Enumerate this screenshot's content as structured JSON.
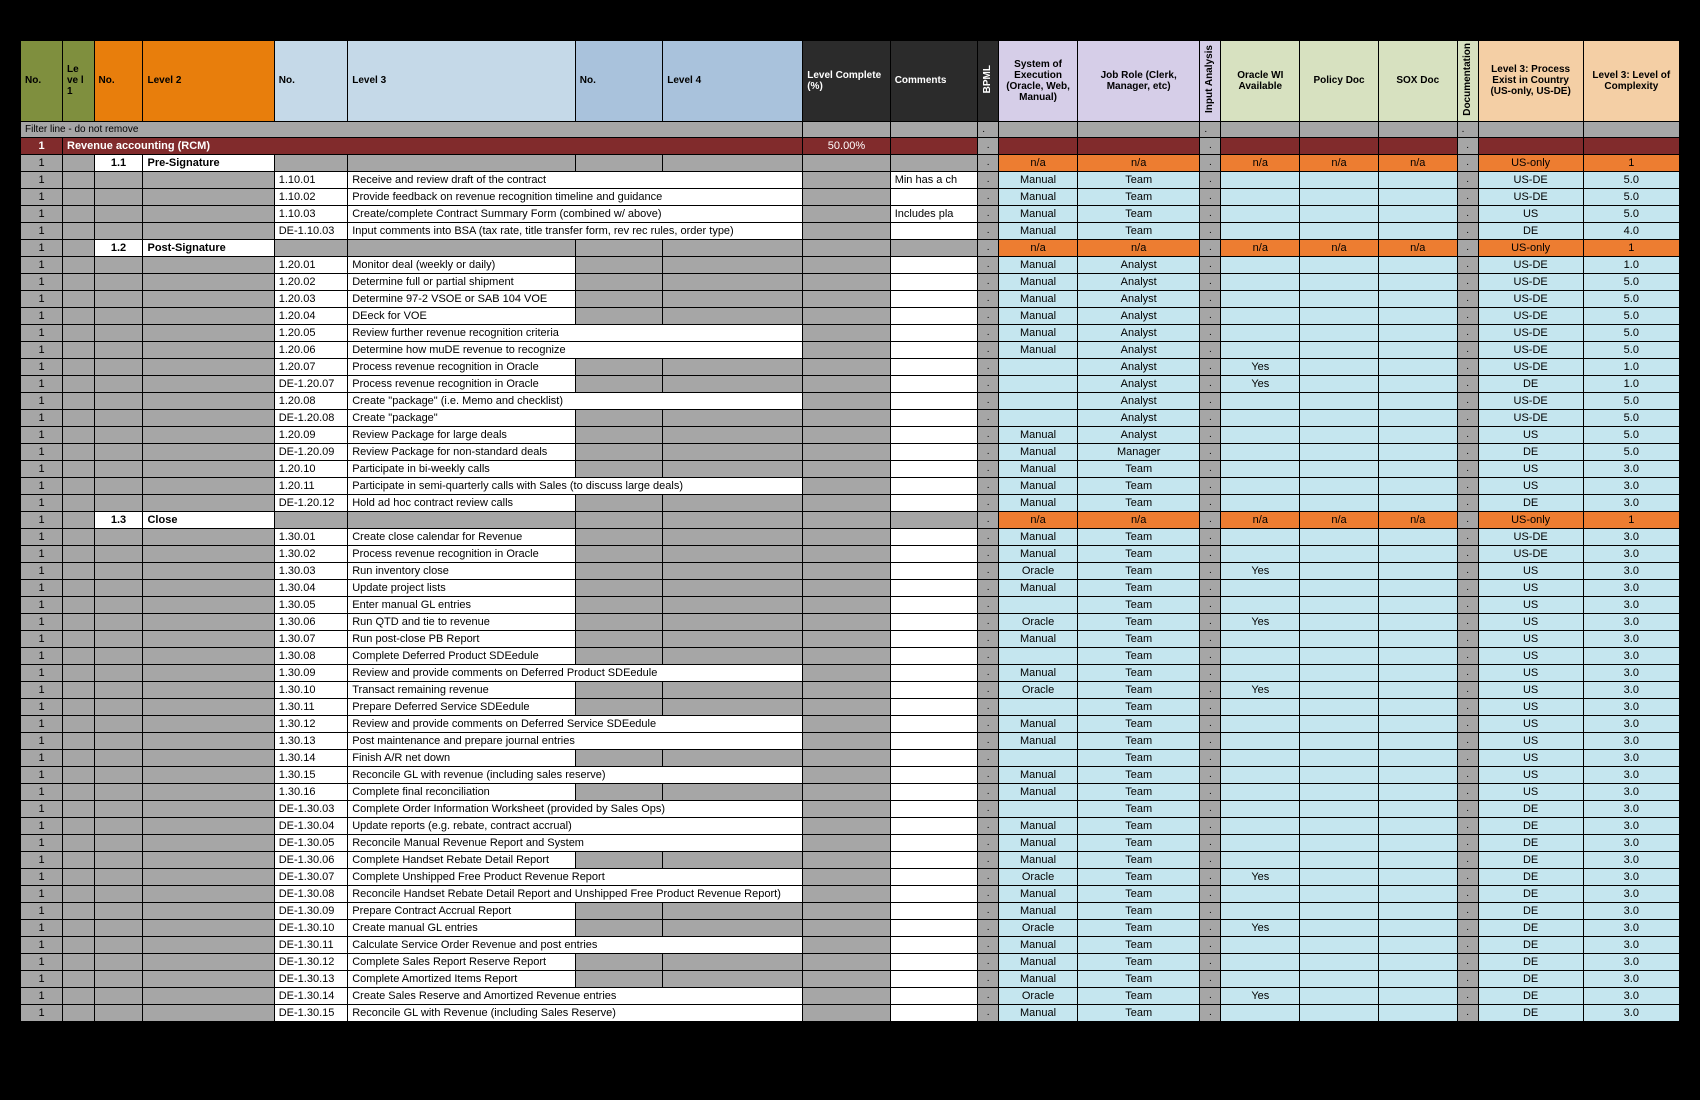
{
  "headers": {
    "no1": "No.",
    "lvl1": "Le ve l 1",
    "no2": "No.",
    "lvl2": "Level 2",
    "no3": "No.",
    "lvl3": "Level 3",
    "no4": "No.",
    "lvl4": "Level 4",
    "pct": "Level Complete (%)",
    "comments": "Comments",
    "bpml": "BPML",
    "system": "System of Execution (Oracle, Web, Manual)",
    "job": "Job Role (Clerk, Manager, etc)",
    "input": "Input Analysis",
    "oracle": "Oracle WI Available",
    "policy": "Policy Doc",
    "sox": "SOX Doc",
    "docu": "Documentation",
    "country": "Level 3: Process Exist in Country (US-only, US-DE)",
    "complexity": "Level 3: Level of Complexity"
  },
  "filterLine": "Filter line - do not remove",
  "dot": ".",
  "na": "n/a",
  "topRow": {
    "no1": "1",
    "title": "Revenue accounting (RCM)",
    "pct": "50.00%"
  },
  "groups": [
    {
      "no": "1.1",
      "name": "Pre-Signature",
      "country": "US-only",
      "cx": "1"
    },
    {
      "no": "1.2",
      "name": "Post-Signature",
      "country": "US-only",
      "cx": "1"
    },
    {
      "no": "1.3",
      "name": "Close",
      "country": "US-only",
      "cx": "1"
    }
  ],
  "rows": [
    {
      "g": 0,
      "c4": "1.10.01",
      "c5": "Receive and review draft of the contract",
      "comments": "Min has a ch",
      "sys": "Manual",
      "job": "Team",
      "country": "US-DE",
      "cx": "5.0"
    },
    {
      "g": 0,
      "c4": "1.10.02",
      "c5": "Provide feedback on revenue recognition timeline and guidance",
      "sys": "Manual",
      "job": "Team",
      "country": "US-DE",
      "cx": "5.0"
    },
    {
      "g": 0,
      "c4": "1.10.03",
      "c5": "Create/complete Contract Summary Form (combined w/ above)",
      "comments": "Includes pla",
      "sys": "Manual",
      "job": "Team",
      "country": "US",
      "cx": "5.0"
    },
    {
      "g": 0,
      "c4": "DE-1.10.03",
      "c5": "Input comments into BSA (tax rate, title transfer form, rev rec rules, order type)",
      "sys": "Manual",
      "job": "Team",
      "country": "DE",
      "cx": "4.0"
    },
    {
      "g": 1,
      "c4": "1.20.01",
      "c5": "Monitor deal (weekly or daily)",
      "sys": "Manual",
      "job": "Analyst",
      "country": "US-DE",
      "cx": "1.0"
    },
    {
      "g": 1,
      "c4": "1.20.02",
      "c5": "Determine full or partial shipment",
      "sys": "Manual",
      "job": "Analyst",
      "country": "US-DE",
      "cx": "5.0"
    },
    {
      "g": 1,
      "c4": "1.20.03",
      "c5": "Determine 97-2 VSOE or SAB 104 VOE",
      "sys": "Manual",
      "job": "Analyst",
      "country": "US-DE",
      "cx": "5.0"
    },
    {
      "g": 1,
      "c4": "1.20.04",
      "c5": "DEeck for VOE",
      "sys": "Manual",
      "job": "Analyst",
      "country": "US-DE",
      "cx": "5.0"
    },
    {
      "g": 1,
      "c4": "1.20.05",
      "c5": "Review further revenue recognition criteria",
      "sys": "Manual",
      "job": "Analyst",
      "country": "US-DE",
      "cx": "5.0"
    },
    {
      "g": 1,
      "c4": "1.20.06",
      "c5": "Determine how muDE revenue to recognize",
      "sys": "Manual",
      "job": "Analyst",
      "country": "US-DE",
      "cx": "5.0"
    },
    {
      "g": 1,
      "c4": "1.20.07",
      "c5": "Process revenue recognition in Oracle",
      "job": "Analyst",
      "oracle": "Yes",
      "country": "US-DE",
      "cx": "1.0"
    },
    {
      "g": 1,
      "c4": "DE-1.20.07",
      "c5": "Process revenue recognition in Oracle",
      "job": "Analyst",
      "oracle": "Yes",
      "country": "DE",
      "cx": "1.0"
    },
    {
      "g": 1,
      "c4": "1.20.08",
      "c5": "Create \"package\" (i.e. Memo and checklist)",
      "job": "Analyst",
      "country": "US-DE",
      "cx": "5.0"
    },
    {
      "g": 1,
      "c4": "DE-1.20.08",
      "c5": "Create \"package\"",
      "job": "Analyst",
      "country": "US-DE",
      "cx": "5.0"
    },
    {
      "g": 1,
      "c4": "1.20.09",
      "c5": "Review Package for large deals",
      "sys": "Manual",
      "job": "Analyst",
      "country": "US",
      "cx": "5.0"
    },
    {
      "g": 1,
      "c4": "DE-1.20.09",
      "c5": "Review Package for non-standard deals",
      "sys": "Manual",
      "job": "Manager",
      "country": "DE",
      "cx": "5.0"
    },
    {
      "g": 1,
      "c4": "1.20.10",
      "c5": "Participate in bi-weekly calls",
      "sys": "Manual",
      "job": "Team",
      "country": "US",
      "cx": "3.0"
    },
    {
      "g": 1,
      "c4": "1.20.11",
      "c5": "Participate in semi-quarterly calls with Sales (to discuss large deals)",
      "sys": "Manual",
      "job": "Team",
      "country": "US",
      "cx": "3.0"
    },
    {
      "g": 1,
      "c4": "DE-1.20.12",
      "c5": "Hold ad hoc contract review calls",
      "sys": "Manual",
      "job": "Team",
      "country": "DE",
      "cx": "3.0"
    },
    {
      "g": 2,
      "c4": "1.30.01",
      "c5": "Create close calendar for Revenue",
      "sys": "Manual",
      "job": "Team",
      "country": "US-DE",
      "cx": "3.0"
    },
    {
      "g": 2,
      "c4": "1.30.02",
      "c5": "Process revenue recognition in Oracle",
      "sys": "Manual",
      "job": "Team",
      "country": "US-DE",
      "cx": "3.0"
    },
    {
      "g": 2,
      "c4": "1.30.03",
      "c5": "Run inventory close",
      "sys": "Oracle",
      "job": "Team",
      "oracle": "Yes",
      "country": "US",
      "cx": "3.0"
    },
    {
      "g": 2,
      "c4": "1.30.04",
      "c5": "Update project lists",
      "sys": "Manual",
      "job": "Team",
      "country": "US",
      "cx": "3.0"
    },
    {
      "g": 2,
      "c4": "1.30.05",
      "c5": "Enter manual GL entries",
      "job": "Team",
      "country": "US",
      "cx": "3.0"
    },
    {
      "g": 2,
      "c4": "1.30.06",
      "c5": "Run QTD and tie to revenue",
      "sys": "Oracle",
      "job": "Team",
      "oracle": "Yes",
      "country": "US",
      "cx": "3.0"
    },
    {
      "g": 2,
      "c4": "1.30.07",
      "c5": "Run post-close PB Report",
      "sys": "Manual",
      "job": "Team",
      "country": "US",
      "cx": "3.0"
    },
    {
      "g": 2,
      "c4": "1.30.08",
      "c5": "Complete Deferred Product SDEedule",
      "job": "Team",
      "country": "US",
      "cx": "3.0"
    },
    {
      "g": 2,
      "c4": "1.30.09",
      "c5": "Review and provide comments on Deferred Product SDEedule",
      "sys": "Manual",
      "job": "Team",
      "country": "US",
      "cx": "3.0"
    },
    {
      "g": 2,
      "c4": "1.30.10",
      "c5": "Transact remaining revenue",
      "sys": "Oracle",
      "job": "Team",
      "oracle": "Yes",
      "country": "US",
      "cx": "3.0"
    },
    {
      "g": 2,
      "c4": "1.30.11",
      "c5": "Prepare Deferred Service SDEedule",
      "job": "Team",
      "country": "US",
      "cx": "3.0"
    },
    {
      "g": 2,
      "c4": "1.30.12",
      "c5": "Review and provide comments on Deferred Service SDEedule",
      "sys": "Manual",
      "job": "Team",
      "country": "US",
      "cx": "3.0"
    },
    {
      "g": 2,
      "c4": "1.30.13",
      "c5": "Post maintenance and prepare journal entries",
      "sys": "Manual",
      "job": "Team",
      "country": "US",
      "cx": "3.0"
    },
    {
      "g": 2,
      "c4": "1.30.14",
      "c5": "Finish A/R net down",
      "job": "Team",
      "country": "US",
      "cx": "3.0"
    },
    {
      "g": 2,
      "c4": "1.30.15",
      "c5": "Reconcile GL with revenue (including sales reserve)",
      "sys": "Manual",
      "job": "Team",
      "country": "US",
      "cx": "3.0"
    },
    {
      "g": 2,
      "c4": "1.30.16",
      "c5": "Complete final reconciliation",
      "sys": "Manual",
      "job": "Team",
      "country": "US",
      "cx": "3.0"
    },
    {
      "g": 2,
      "c4": "DE-1.30.03",
      "c5": "Complete Order Information Worksheet (provided by Sales Ops)",
      "job": "Team",
      "country": "DE",
      "cx": "3.0"
    },
    {
      "g": 2,
      "c4": "DE-1.30.04",
      "c5": "Update reports (e.g. rebate, contract accrual)",
      "sys": "Manual",
      "job": "Team",
      "country": "DE",
      "cx": "3.0"
    },
    {
      "g": 2,
      "c4": "DE-1.30.05",
      "c5": "Reconcile Manual Revenue Report and System",
      "sys": "Manual",
      "job": "Team",
      "country": "DE",
      "cx": "3.0"
    },
    {
      "g": 2,
      "c4": "DE-1.30.06",
      "c5": "Complete Handset Rebate Detail Report",
      "sys": "Manual",
      "job": "Team",
      "country": "DE",
      "cx": "3.0"
    },
    {
      "g": 2,
      "c4": "DE-1.30.07",
      "c5": "Complete Unshipped Free Product Revenue Report",
      "sys": "Oracle",
      "job": "Team",
      "oracle": "Yes",
      "country": "DE",
      "cx": "3.0"
    },
    {
      "g": 2,
      "c4": "DE-1.30.08",
      "c5": "Reconcile Handset Rebate Detail Report and Unshipped Free Product Revenue Report)",
      "sys": "Manual",
      "job": "Team",
      "country": "DE",
      "cx": "3.0"
    },
    {
      "g": 2,
      "c4": "DE-1.30.09",
      "c5": "Prepare Contract Accrual Report",
      "sys": "Manual",
      "job": "Team",
      "country": "DE",
      "cx": "3.0"
    },
    {
      "g": 2,
      "c4": "DE-1.30.10",
      "c5": "Create manual GL entries",
      "sys": "Oracle",
      "job": "Team",
      "oracle": "Yes",
      "country": "DE",
      "cx": "3.0"
    },
    {
      "g": 2,
      "c4": "DE-1.30.11",
      "c5": "Calculate Service Order Revenue and post entries",
      "sys": "Manual",
      "job": "Team",
      "country": "DE",
      "cx": "3.0"
    },
    {
      "g": 2,
      "c4": "DE-1.30.12",
      "c5": "Complete Sales Report Reserve Report",
      "sys": "Manual",
      "job": "Team",
      "country": "DE",
      "cx": "3.0"
    },
    {
      "g": 2,
      "c4": "DE-1.30.13",
      "c5": "Complete Amortized Items Report",
      "sys": "Manual",
      "job": "Team",
      "country": "DE",
      "cx": "3.0"
    },
    {
      "g": 2,
      "c4": "DE-1.30.14",
      "c5": "Create Sales Reserve and Amortized Revenue entries",
      "sys": "Oracle",
      "job": "Team",
      "oracle": "Yes",
      "country": "DE",
      "cx": "3.0"
    },
    {
      "g": 2,
      "c4": "DE-1.30.15",
      "c5": "Reconcile GL with Revenue (including Sales Reserve)",
      "sys": "Manual",
      "job": "Team",
      "country": "DE",
      "cx": "3.0"
    }
  ]
}
